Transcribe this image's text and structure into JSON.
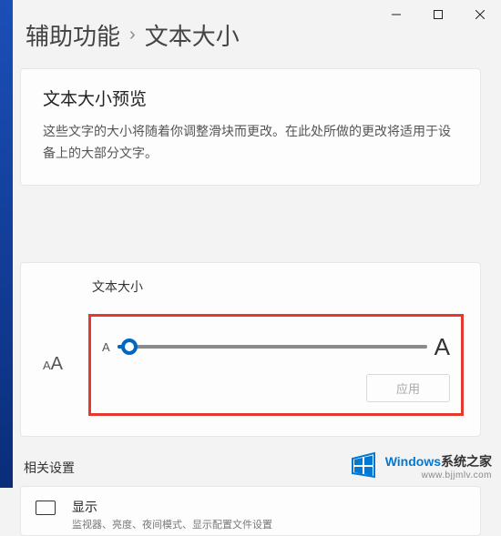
{
  "breadcrumb": {
    "parent": "辅助功能",
    "current": "文本大小"
  },
  "preview": {
    "title": "文本大小预览",
    "desc": "这些文字的大小将随着你调整滑块而更改。在此处所做的更改将适用于设备上的大部分文字。"
  },
  "textSize": {
    "label": "文本大小",
    "iconSmall": "A",
    "iconBig": "A",
    "sliderSmall": "A",
    "sliderBig": "A",
    "applyLabel": "应用",
    "sliderValue": 4
  },
  "related": {
    "sectionTitle": "相关设置",
    "display": {
      "title": "显示",
      "sub": "监视器、亮度、夜间模式、显示配置文件设置"
    }
  },
  "watermark": {
    "brand1": "Windows",
    "brand2": "系统之家",
    "url": "www.bjjmlv.com"
  }
}
